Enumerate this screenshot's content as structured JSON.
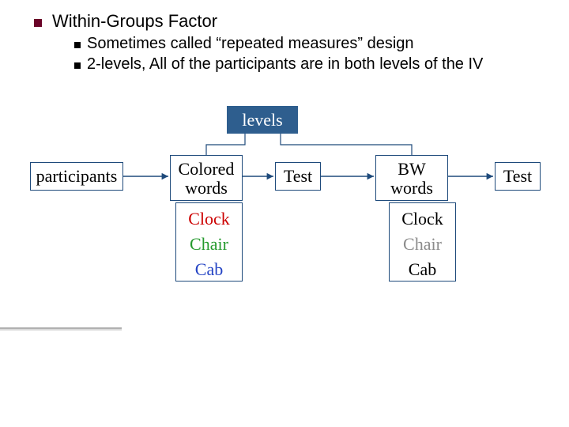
{
  "header": {
    "title": "Within-Groups Factor",
    "bullets": [
      "Sometimes called “repeated measures” design",
      "2-levels, All of the participants are in both levels of the IV"
    ]
  },
  "diagram": {
    "levels_label": "levels",
    "participants_label": "participants",
    "stage1": {
      "level_label": "Colored\nwords",
      "test_label": "Test"
    },
    "stage2": {
      "level_label": "BW\nwords",
      "test_label": "Test"
    },
    "words": {
      "colored": [
        {
          "text": "Clock",
          "color_class": "w-red"
        },
        {
          "text": "Chair",
          "color_class": "w-green"
        },
        {
          "text": "Cab",
          "color_class": "w-blue"
        }
      ],
      "bw": [
        {
          "text": "Clock",
          "color_class": ""
        },
        {
          "text": "Chair",
          "color_class": "w-gray"
        },
        {
          "text": "Cab",
          "color_class": ""
        }
      ]
    }
  }
}
